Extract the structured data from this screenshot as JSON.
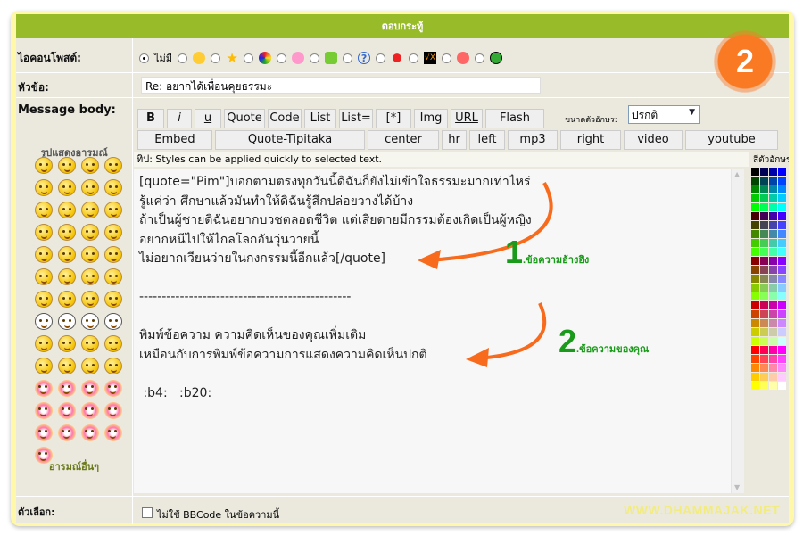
{
  "header": {
    "title": "ตอบกระทู้"
  },
  "post_icon": {
    "label": "ไอคอนโพสต์:",
    "none_label": "ไม่มี",
    "icons": [
      "flower-wheel-icon",
      "star-icon",
      "rainbow-circle-icon",
      "pink-flower-icon",
      "green-bell-icon",
      "question-icon",
      "red-sun-icon",
      "checkx-icon",
      "red-face-icon",
      "grin-face-icon"
    ]
  },
  "subject": {
    "label": "หัวข้อ:",
    "value": "Re: อยากได้เพื่อนคุยธรรมะ"
  },
  "message": {
    "label": "Message body:"
  },
  "emoticons": {
    "title": "รูปแสดงอารมณ์",
    "more_label": "อารมณ์อื่นๆ"
  },
  "toolbar": {
    "row1": [
      "B",
      "i",
      "u",
      "Quote",
      "Code",
      "List",
      "List=",
      "[*]",
      "Img",
      "URL",
      "Flash"
    ],
    "row2": [
      "Embed",
      "Quote-Tipitaka",
      "center",
      "hr",
      "left",
      "mp3",
      "right",
      "video",
      "youtube"
    ],
    "font_size_label": "ขนาดตัวอักษร:",
    "font_size_value": "ปรกติ",
    "color_label": "สีตัวอักษร"
  },
  "tip": "ทิป: Styles can be applied quickly to selected text.",
  "textarea": {
    "value": "[quote=\"Pim\"]บอกตามตรงทุกวันนี้ดิฉันก็ยังไม่เข้าใจธรรมะมากเท่าไหร่\nรู้แค่ว่า ศึกษาแล้วมันทำให้ดิฉันรู้สึกปล่อยวางได้บ้าง\nถ้าเป็นผู้ชายดิฉันอยากบวชตลอดชีวิต แต่เสียดายมีกรรมต้องเกิดเป็นผู้หญิง\nอยากหนีไปให้ไกลโลกอันวุ่นวายนี้\nไม่อยากเวียนว่ายในกงกรรมนี้อีกแล้ว[/quote]\n\n-----------------------------------------------\n\nพิมพ์ข้อความ ความคิดเห็นของคุณเพิ่มเติม\nเหมือนกับการพิมพ์ข้อความการแสดงความคิดเห็นปกติ\n\n :b4:   :b20:"
  },
  "annotations": {
    "badge": "2",
    "note1_num": "1",
    "note1_text": ".ข้อความอ้างอิง",
    "note2_num": "2",
    "note2_text": ".ข้อความของคุณ",
    "accent": "#f97a22",
    "note_color": "#1a9a1a"
  },
  "options": {
    "label": "ตัวเลือก:",
    "disable_bbcode": "ไม่ใช้ BBCode ในข้อความนี้",
    "disable_bbcode_checked": false
  },
  "watermark": "WWW.DHAMMAJAK.NET"
}
